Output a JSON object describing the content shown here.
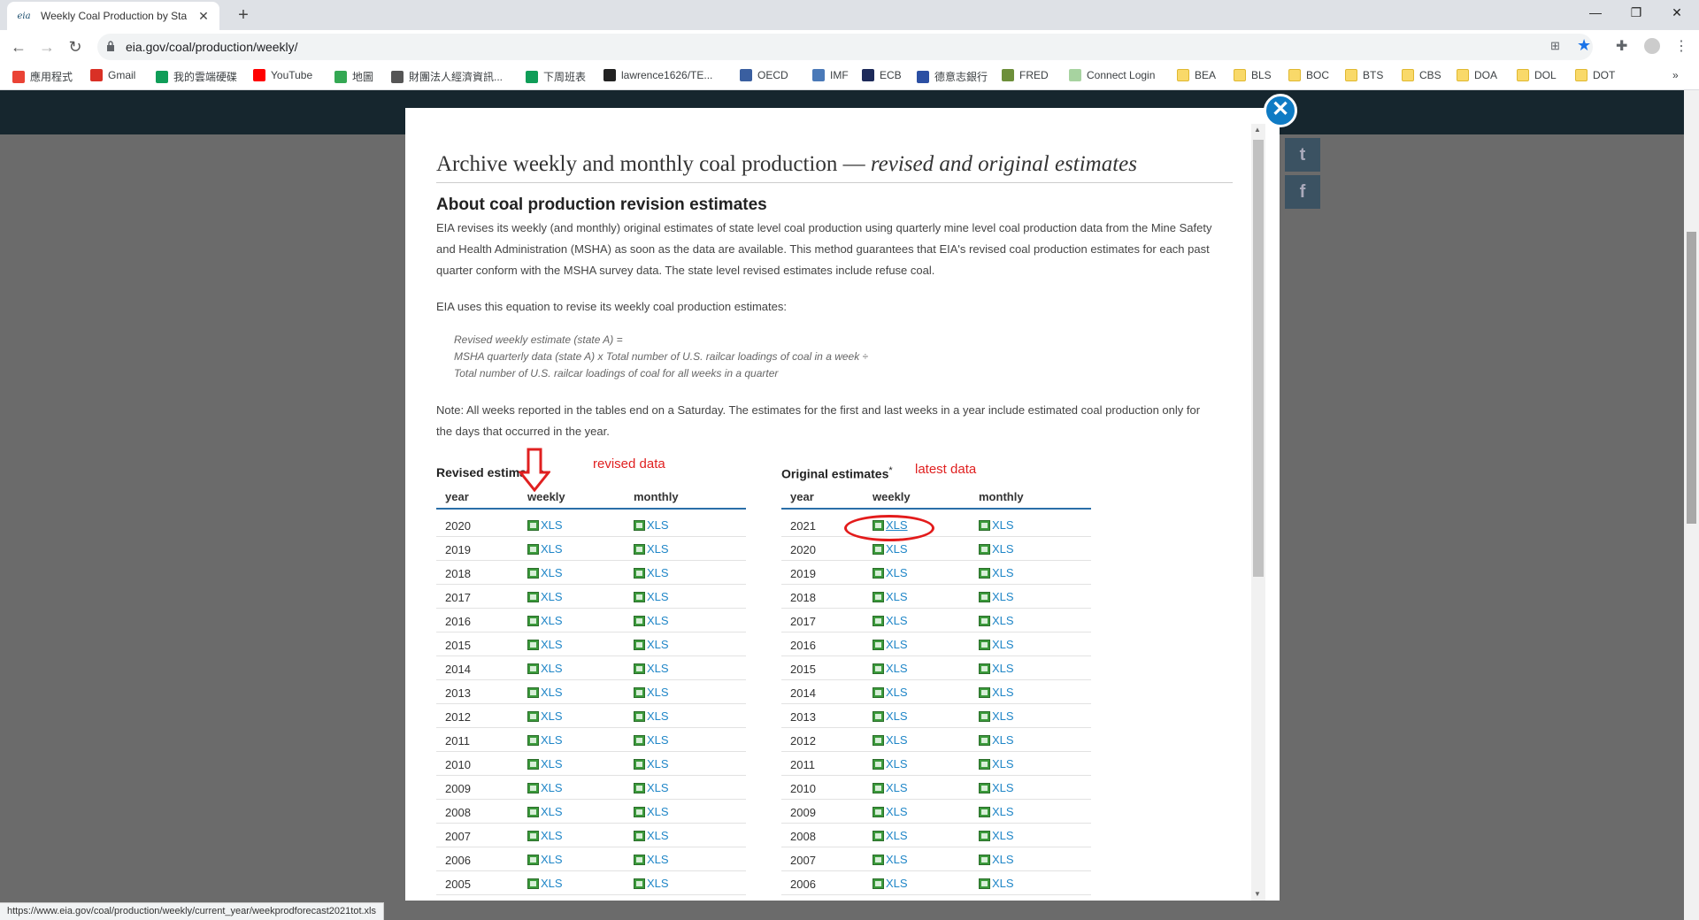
{
  "browser": {
    "tab_title": "Weekly Coal Production by Sta",
    "favicon_text": "eia",
    "url": "eia.gov/coal/production/weekly/",
    "status_url": "https://www.eia.gov/coal/production/weekly/current_year/weekprodforecast2021tot.xls"
  },
  "bookmarks": [
    {
      "label": "應用程式",
      "color": "#ea4335"
    },
    {
      "label": "Gmail",
      "color": "#d93025"
    },
    {
      "label": "我的雲端硬碟",
      "color": "#0f9d58"
    },
    {
      "label": "YouTube",
      "color": "#ff0000"
    },
    {
      "label": "地圖",
      "color": "#34a853"
    },
    {
      "label": "財團法人經濟資訊...",
      "color": "#555555"
    },
    {
      "label": "下周班表",
      "color": "#0f9d58"
    },
    {
      "label": "lawrence1626/TE...",
      "color": "#222222"
    },
    {
      "label": "OECD",
      "color": "#3a5fa0"
    },
    {
      "label": "IMF",
      "color": "#4a79b8"
    },
    {
      "label": "ECB",
      "color": "#1d2a5a"
    },
    {
      "label": "德意志銀行",
      "color": "#2b4fa3"
    },
    {
      "label": "FRED",
      "color": "#6d8f3a"
    },
    {
      "label": "Connect Login",
      "color": "#a7d3a0"
    },
    {
      "label": "BEA",
      "folder": true
    },
    {
      "label": "BLS",
      "folder": true
    },
    {
      "label": "BOC",
      "folder": true
    },
    {
      "label": "BTS",
      "folder": true
    },
    {
      "label": "CBS",
      "folder": true
    },
    {
      "label": "DOA",
      "folder": true
    },
    {
      "label": "DOL",
      "folder": true
    },
    {
      "label": "DOT",
      "folder": true
    }
  ],
  "modal": {
    "title_main": "Archive weekly and monthly coal production — ",
    "title_em": "revised and original estimates",
    "heading": "About coal production revision estimates",
    "para1": "EIA revises its weekly (and monthly) original estimates of state level coal production using quarterly mine level coal production data from the Mine Safety and Health Administration (MSHA) as soon as the data are available. This method guarantees that EIA's revised coal production estimates for each past quarter conform with the MSHA survey data. The state level revised estimates include refuse coal.",
    "para2": "EIA uses this equation to revise its weekly coal production estimates:",
    "eq1": "Revised weekly estimate (state A) =",
    "eq2": "MSHA quarterly data (state A) x Total number of U.S. railcar loadings of coal in a week ÷",
    "eq3": "Total number of U.S. railcar loadings of coal for all weeks in a quarter",
    "note": "Note: All weeks reported in the tables end on a Saturday. The estimates for the first and last weeks in a year include estimated coal production only for the days that occurred in the year.",
    "revised": {
      "title": "Revised estimates",
      "annotation": "revised data",
      "cols": [
        "year",
        "weekly",
        "monthly"
      ],
      "years": [
        "2020",
        "2019",
        "2018",
        "2017",
        "2016",
        "2015",
        "2014",
        "2013",
        "2012",
        "2011",
        "2010",
        "2009",
        "2008",
        "2007",
        "2006",
        "2005"
      ]
    },
    "original": {
      "title": "Original estimates",
      "title_sup": "*",
      "annotation": "latest data",
      "cols": [
        "year",
        "weekly",
        "monthly"
      ],
      "years": [
        "2021",
        "2020",
        "2019",
        "2018",
        "2017",
        "2016",
        "2015",
        "2014",
        "2013",
        "2012",
        "2011",
        "2010",
        "2009",
        "2008",
        "2007",
        "2006"
      ]
    },
    "link_label": "XLS"
  }
}
